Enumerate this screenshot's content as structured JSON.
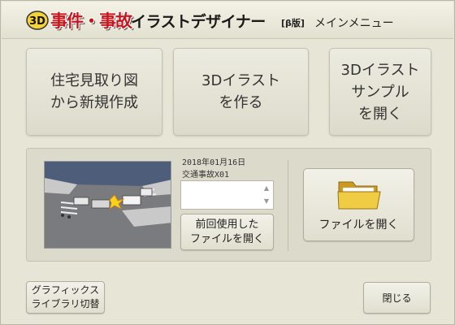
{
  "titlebar": {
    "logo": "3D",
    "title_main": "事件・事故",
    "title_sub": "イラストデザイナー",
    "beta": "[β版]",
    "menu_title": "メインメニュー"
  },
  "main_buttons": {
    "new_from_floorplan": "住宅見取り図\nから新規作成",
    "create_3d": "3Dイラスト\nを作る",
    "open_sample": "3Dイラスト\nサンプル\nを開く"
  },
  "recent": {
    "date": "2018年01月16日",
    "name": "交通事故X01",
    "reopen_label": "前回使用した\nファイルを開く"
  },
  "open_file": {
    "label": "ファイルを開く",
    "icon": "folder-icon"
  },
  "footer": {
    "library_label": "グラフィックス\nライブラリ切替",
    "close_label": "閉じる"
  },
  "colors": {
    "background": "#e7e6d6",
    "title_red": "#c8141a",
    "folder_yellow": "#e8c23a"
  }
}
